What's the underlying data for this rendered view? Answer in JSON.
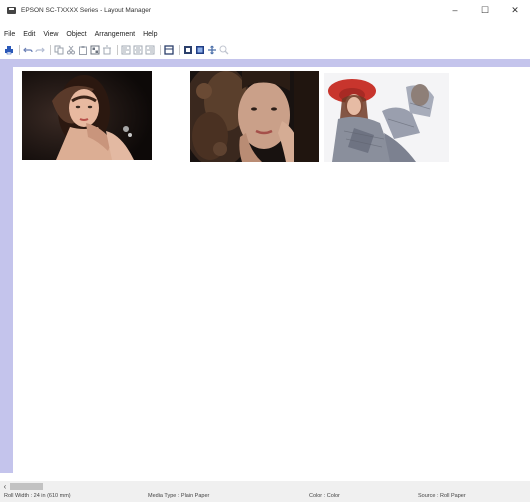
{
  "window": {
    "title": "EPSON SC-TXXXX Series - Layout Manager",
    "controls": {
      "minimize": "–",
      "maximize": "☐",
      "close": "✕"
    }
  },
  "menu": [
    "File",
    "Edit",
    "View",
    "Object",
    "Arrangement",
    "Help"
  ],
  "toolbar": [
    {
      "icon": "printer-icon",
      "color": "#2b59b8"
    },
    "sep",
    {
      "icon": "undo-icon",
      "color": "#6a7fb5"
    },
    {
      "icon": "redo-icon",
      "color": "#b4bdd3"
    },
    "sep",
    {
      "icon": "copy-icon",
      "color": "#9aa0ab"
    },
    {
      "icon": "cut-icon",
      "color": "#9aa0ab"
    },
    {
      "icon": "paste-icon",
      "color": "#9aa0ab"
    },
    {
      "icon": "layout-icon",
      "color": "#6d7480"
    },
    {
      "icon": "delete-icon",
      "color": "#a2a8b3"
    },
    "sep",
    {
      "icon": "align-left-icon",
      "color": "#a2a8b3"
    },
    {
      "icon": "align-center-icon",
      "color": "#a2a8b3"
    },
    {
      "icon": "align-right-icon",
      "color": "#a2a8b3"
    },
    "sep",
    {
      "icon": "frame-icon",
      "color": "#2b3f6b"
    },
    "sep",
    {
      "icon": "page-view-icon",
      "color": "#2b3f6b"
    },
    {
      "icon": "fit-view-icon",
      "color": "#1f3d85"
    },
    {
      "icon": "move-icon",
      "color": "#4a6ea8"
    },
    {
      "icon": "zoom-icon",
      "color": "#c0c5d0"
    }
  ],
  "colors": {
    "workspace": "#c4c4ec",
    "page": "#ffffff",
    "accent": "#2b59b8"
  },
  "photos": [
    {
      "name": "photo-woman-dark-hair-black-background"
    },
    {
      "name": "photo-woman-curly-hair-closeup"
    },
    {
      "name": "photo-woman-red-hat-gray-jacket"
    }
  ],
  "scrollbar": {
    "arrow": "‹"
  },
  "status": {
    "roll_width": "Roll Width : 24 in (610 mm)",
    "media_type": "Media Type : Plain Paper",
    "color": "Color : Color",
    "source": "Source : Roll Paper"
  }
}
